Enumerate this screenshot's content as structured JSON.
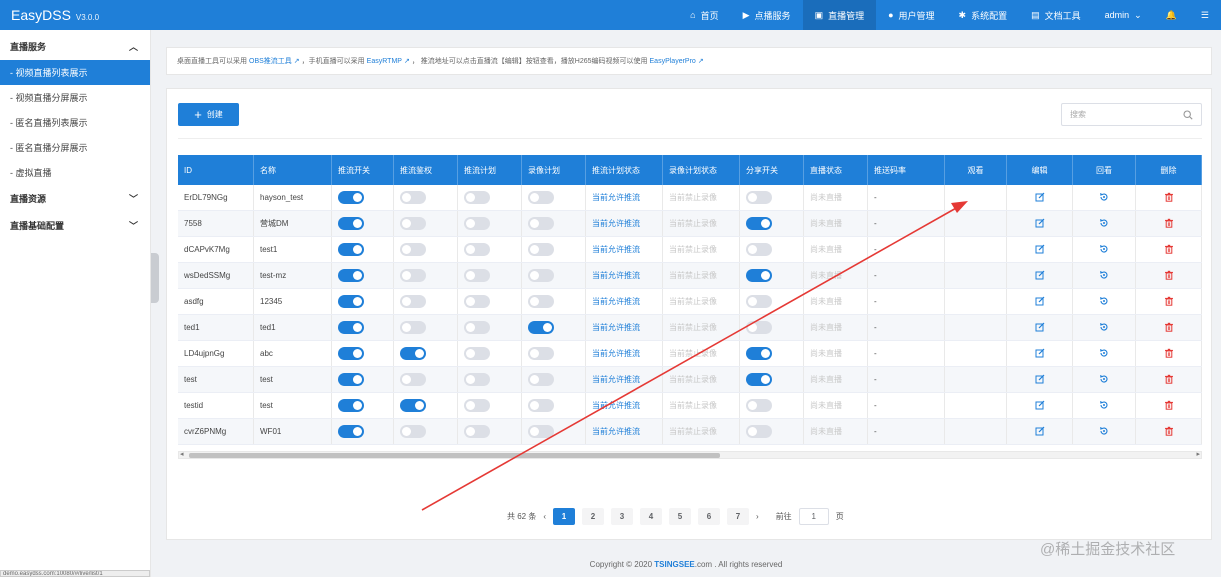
{
  "app": {
    "name": "EasyDSS",
    "version": "V3.0.0"
  },
  "topnav": [
    {
      "label": "首页",
      "icon": "home-icon"
    },
    {
      "label": "点播服务",
      "icon": "video-camera-icon"
    },
    {
      "label": "直播管理",
      "icon": "live-tv-icon",
      "active": true
    },
    {
      "label": "用户管理",
      "icon": "user-icon"
    },
    {
      "label": "系统配置",
      "icon": "gear-icon"
    },
    {
      "label": "文档工具",
      "icon": "document-icon"
    },
    {
      "label": "admin",
      "icon": "chevron-down-icon"
    }
  ],
  "sidebar": {
    "groups": [
      {
        "label": "直播服务",
        "expanded": true,
        "items": [
          {
            "label": "- 视频直播列表展示",
            "active": true
          },
          {
            "label": "- 视频直播分屏展示"
          },
          {
            "label": "- 匿名直播列表展示"
          },
          {
            "label": "- 匿名直播分屏展示"
          },
          {
            "label": "- 虚拟直播"
          }
        ]
      },
      {
        "label": "直播资源",
        "expanded": false,
        "items": []
      },
      {
        "label": "直播基础配置",
        "expanded": false,
        "items": []
      }
    ]
  },
  "notice": {
    "t1": "桌面直播工具可以采用",
    "l1": "OBS推流工具",
    "t2": "，手机直播可以采用",
    "l2": "EasyRTMP",
    "t3": "，  推流地址可以点击直播流【编辑】按钮查看，播放H265编码视频可以使用",
    "l3": "EasyPlayerPro"
  },
  "toolbar": {
    "create_label": "创建",
    "search_placeholder": "搜索"
  },
  "table": {
    "headers": [
      "ID",
      "名称",
      "推流开关",
      "推流鉴权",
      "推流计划",
      "录像计划",
      "推流计划状态",
      "录像计划状态",
      "分享开关",
      "直播状态",
      "推送码率",
      "观看",
      "编辑",
      "回看",
      "删除"
    ],
    "push_plan_status": "当前允许推流",
    "record_plan_status": "当前禁止录像",
    "live_status": "尚未直播",
    "bitrate": "-",
    "rows": [
      {
        "id": "ErDL79NGg",
        "name": "hayson_test",
        "push": true,
        "auth": false,
        "plan": false,
        "rec": false,
        "share": false
      },
      {
        "id": "7558",
        "name": "营城DM",
        "push": true,
        "auth": false,
        "plan": false,
        "rec": false,
        "share": true
      },
      {
        "id": "dCAPvK7Mg",
        "name": "test1",
        "push": true,
        "auth": false,
        "plan": false,
        "rec": false,
        "share": false
      },
      {
        "id": "wsDedSSMg",
        "name": "test-mz",
        "push": true,
        "auth": false,
        "plan": false,
        "rec": false,
        "share": true
      },
      {
        "id": "asdfg",
        "name": "12345",
        "push": true,
        "auth": false,
        "plan": false,
        "rec": false,
        "share": false
      },
      {
        "id": "ted1",
        "name": "ted1",
        "push": true,
        "auth": false,
        "plan": false,
        "rec": true,
        "share": false
      },
      {
        "id": "LD4ujpnGg",
        "name": "abc",
        "push": true,
        "auth": true,
        "plan": false,
        "rec": false,
        "share": true
      },
      {
        "id": "test",
        "name": "test",
        "push": true,
        "auth": false,
        "plan": false,
        "rec": false,
        "share": true
      },
      {
        "id": "testid",
        "name": "test",
        "push": true,
        "auth": true,
        "plan": false,
        "rec": false,
        "share": false
      },
      {
        "id": "cvrZ6PNMg",
        "name": "WF01",
        "push": true,
        "auth": false,
        "plan": false,
        "rec": false,
        "share": false
      }
    ]
  },
  "pagination": {
    "total_text": "共 62 条",
    "pages": [
      "1",
      "2",
      "3",
      "4",
      "5",
      "6",
      "7"
    ],
    "current": "1",
    "goto_label": "前往",
    "goto_value": "1",
    "page_suffix": "页"
  },
  "footer": {
    "prefix": "Copyright © 2020",
    "brand": "TSINGSEE",
    "suffix": ".com . All rights reserved"
  },
  "statusbar": {
    "url": "demo.easydss.com:10080/#/live/list/1"
  },
  "watermark": "@稀土掘金技术社区",
  "colors": {
    "primary": "#1f7fd8",
    "arrow": "#e53935"
  }
}
